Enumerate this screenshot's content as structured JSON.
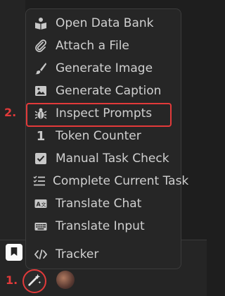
{
  "menu": {
    "items": [
      {
        "label": "Open Data Bank",
        "icon": "book-reader-icon"
      },
      {
        "label": "Attach a File",
        "icon": "paperclip-icon"
      },
      {
        "label": "Generate Image",
        "icon": "paintbrush-icon"
      },
      {
        "label": "Generate Caption",
        "icon": "image-icon"
      },
      {
        "label": "Inspect Prompts",
        "icon": "bug-icon"
      },
      {
        "label": "Token Counter",
        "icon": "number-one-icon"
      },
      {
        "label": "Manual Task Check",
        "icon": "checkbox-icon"
      },
      {
        "label": "Complete Current Task",
        "icon": "list-check-icon"
      },
      {
        "label": "Translate Chat",
        "icon": "language-icon"
      },
      {
        "label": "Translate Input",
        "icon": "keyboard-icon"
      },
      {
        "label": "Tracker",
        "icon": "code-icon"
      }
    ]
  },
  "annotations": {
    "step1": "1.",
    "step2": "2."
  },
  "colors": {
    "highlight": "#e23a3a",
    "menu_bg": "#262626",
    "text": "#d0d0d0",
    "icon": "#c8c8c8"
  }
}
